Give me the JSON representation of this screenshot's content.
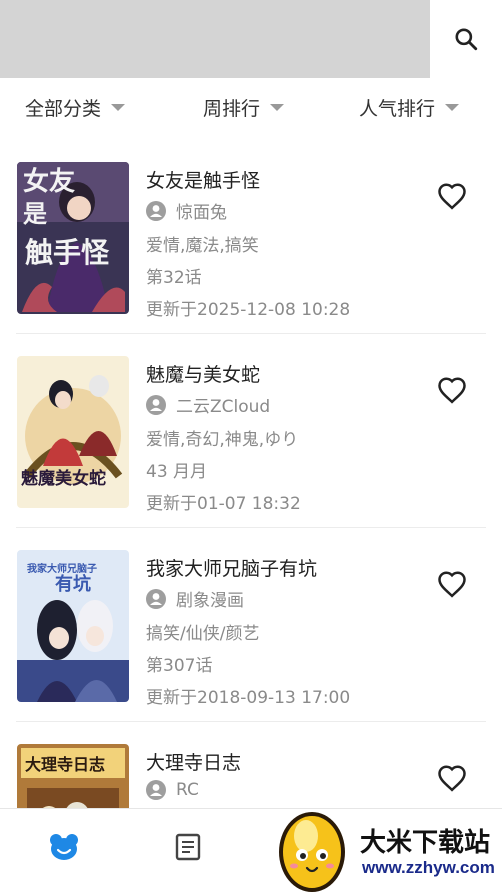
{
  "search": {
    "icon": "search-icon"
  },
  "filters": [
    {
      "label": "全部分类"
    },
    {
      "label": "周排行"
    },
    {
      "label": "人气排行"
    }
  ],
  "comics": [
    {
      "title": "女友是触手怪",
      "author": "惊面兔",
      "tags": "爱情,魔法,搞笑",
      "chapter": "第32话",
      "updated": "更新于2025-12-08 10:28",
      "cover_text": "女友是触手怪"
    },
    {
      "title": "魅魔与美女蛇",
      "author": "二云ZCloud",
      "tags": "爱情,奇幻,神鬼,ゆり",
      "chapter": "43 月月",
      "updated": "更新于01-07 18:32",
      "cover_text": "魅魔美女蛇"
    },
    {
      "title": "我家大师兄脑子有坑",
      "author": "剧象漫画",
      "tags": "搞笑/仙侠/颜艺",
      "chapter": "第307话",
      "updated": "更新于2018-09-13 17:00",
      "cover_text": "我家大师兄脑子有坑"
    },
    {
      "title": "大理寺日志",
      "author": "RC",
      "tags": "",
      "chapter": "",
      "updated": "",
      "cover_text": "大理寺日志"
    }
  ],
  "bottom_nav": [
    {
      "icon": "bear-icon",
      "active": true
    },
    {
      "icon": "document-icon",
      "active": false
    }
  ],
  "watermark": {
    "name": "大米下载站",
    "url": "www.zzhyw.com"
  },
  "colors": {
    "accent": "#1e88e5",
    "muted": "#8a8a8a",
    "search_bg": "#d4d4d4"
  }
}
